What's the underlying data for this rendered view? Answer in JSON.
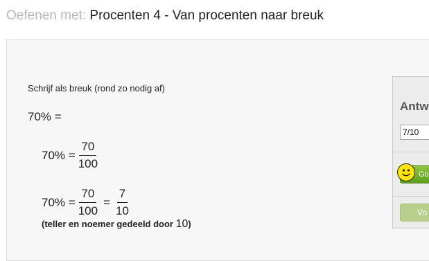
{
  "header": {
    "prefix": "Oefenen met:",
    "title": "Procenten 4 - Van procenten naar breuk"
  },
  "question": {
    "instruction": "Schrijf als breuk (rond zo nodig af)",
    "prompt": "70% =",
    "step1": {
      "lhs": "70% =",
      "num": "70",
      "den": "100"
    },
    "step2": {
      "lhs": "70% =",
      "num1": "70",
      "den1": "100",
      "eq": "=",
      "num2": "7",
      "den2": "10"
    },
    "note_text": "(teller en noemer gedeeld door ",
    "note_value": "10",
    "note_close": ")"
  },
  "side": {
    "title": "Antw",
    "answer_value": "7/10",
    "good_label": "Goe",
    "next_label": "Vo"
  },
  "colors": {
    "header_prefix": "#b8b8b8",
    "good_button": "#6aaa2a",
    "next_button": "#b7cf8a",
    "smiley": "#ffe600"
  }
}
